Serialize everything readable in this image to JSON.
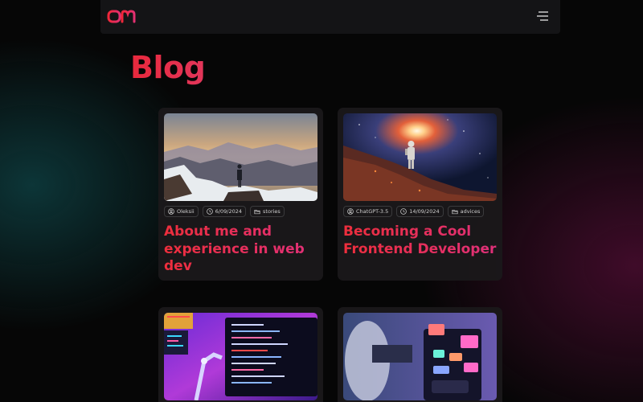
{
  "header": {
    "logo_text": "OM",
    "menu_icon": "hamburger-icon"
  },
  "page": {
    "title": "Blog"
  },
  "posts": [
    {
      "author": "Oleksii",
      "date": "6/09/2024",
      "category": "stories",
      "title": "About me and experience in web dev",
      "image": "hiker-on-mountain-summit"
    },
    {
      "author": "ChatGPT-3.5",
      "date": "14/09/2024",
      "category": "advices",
      "title": "Becoming a Cool Frontend Developer",
      "image": "astronaut-on-planet"
    },
    {
      "image": "neon-code-screen-robot-arm"
    },
    {
      "image": "person-with-tablet-ui-ux"
    }
  ],
  "colors": {
    "accent_red": "#e8283c",
    "accent_pink": "#e0307a",
    "card_bg": "#1a181a",
    "topbar_bg": "#161618"
  }
}
